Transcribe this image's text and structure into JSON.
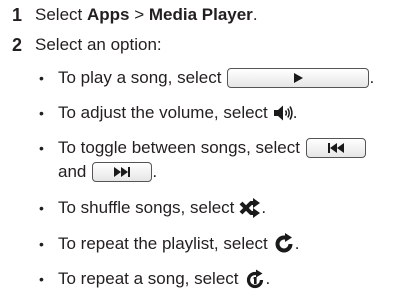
{
  "steps": [
    {
      "number": "1",
      "prefix": "Select ",
      "bold1": "Apps",
      "sep": " > ",
      "bold2": "Media Player",
      "suffix": "."
    },
    {
      "number": "2",
      "text": "Select an option:"
    }
  ],
  "bullets": [
    {
      "dot": "•",
      "text": "To play a song, select",
      "end": "."
    },
    {
      "dot": "•",
      "text": "To adjust the volume, select",
      "end": "."
    },
    {
      "dot": "•",
      "text": "To toggle between songs, select",
      "line2": "and",
      "end": "."
    },
    {
      "dot": "•",
      "text": "To shuffle songs, select",
      "end": "."
    },
    {
      "dot": "•",
      "text": "To repeat the playlist, select",
      "end": "."
    },
    {
      "dot": "•",
      "text": "To repeat a song, select",
      "end": "."
    }
  ],
  "icons": {
    "play": "play-icon",
    "volume": "volume-icon",
    "previous": "previous-track-icon",
    "next": "next-track-icon",
    "shuffle": "shuffle-icon",
    "repeat_playlist": "repeat-icon",
    "repeat_song": "repeat-one-icon"
  },
  "colors": {
    "text": "#231f20",
    "icon": "#1a1a1a",
    "button_border": "#555555"
  }
}
